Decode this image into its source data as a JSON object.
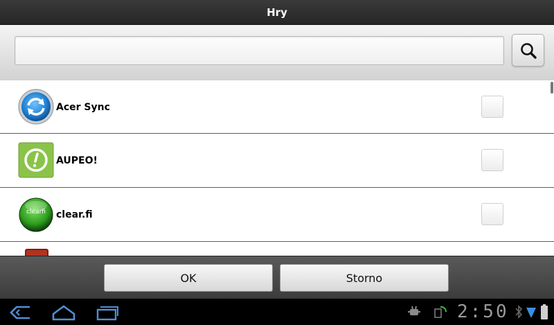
{
  "dialog": {
    "title": "Hry"
  },
  "search": {
    "value": "",
    "placeholder": ""
  },
  "apps": [
    {
      "name": "Acer Sync",
      "icon": "acer-sync-icon",
      "checked": false
    },
    {
      "name": "AUPEO!",
      "icon": "aupeo-icon",
      "checked": false
    },
    {
      "name": "clear.fi",
      "icon": "clearfi-icon",
      "icon_text": "clearfi",
      "checked": false
    }
  ],
  "buttons": {
    "ok": "OK",
    "cancel": "Storno"
  },
  "status": {
    "time": "2:50"
  },
  "colors": {
    "accent_blue": "#1e88d6",
    "aupeo_green": "#8bc34a",
    "clearfi_green": "#2e9e1e",
    "clock": "#9a9a9a"
  }
}
